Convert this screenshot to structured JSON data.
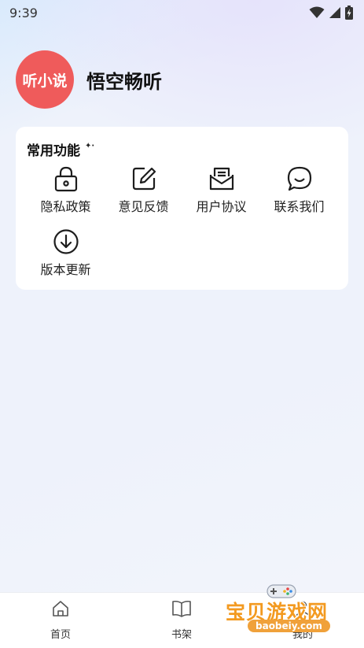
{
  "status_bar": {
    "time": "9:39",
    "icons": [
      "wifi-icon",
      "signal-icon",
      "battery-charging-icon"
    ]
  },
  "profile": {
    "avatar_text": "听小说",
    "avatar_color": "#ef5b5b",
    "app_name": "悟空畅听"
  },
  "common_functions": {
    "title": "常用功能",
    "items": [
      {
        "label": "隐私政策",
        "icon": "lock-icon"
      },
      {
        "label": "意见反馈",
        "icon": "edit-icon"
      },
      {
        "label": "用户协议",
        "icon": "mail-icon"
      },
      {
        "label": "联系我们",
        "icon": "chat-icon"
      },
      {
        "label": "版本更新",
        "icon": "download-icon"
      }
    ]
  },
  "tabbar": {
    "items": [
      {
        "label": "首页",
        "icon": "home-icon"
      },
      {
        "label": "书架",
        "icon": "book-icon"
      },
      {
        "label": "我的",
        "icon": "user-icon"
      }
    ]
  },
  "watermark": {
    "text": "宝贝游戏网",
    "url": "baobeiy.com",
    "color": "#f39a20"
  }
}
